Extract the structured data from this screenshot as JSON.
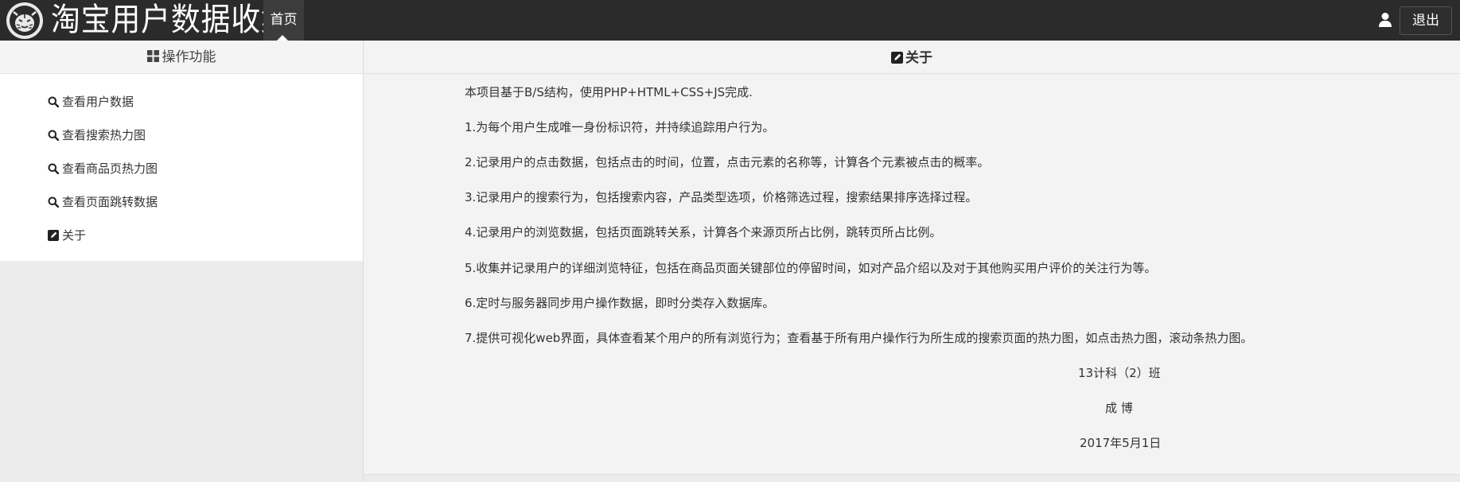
{
  "navbar": {
    "brand_title": "淘宝用户数据收集",
    "home_label": "首页",
    "logout_label": "退出"
  },
  "sidebar": {
    "header": "操作功能",
    "items": [
      {
        "label": "查看用户数据",
        "icon": "search-icon"
      },
      {
        "label": "查看搜索热力图",
        "icon": "search-icon"
      },
      {
        "label": "查看商品页热力图",
        "icon": "search-icon"
      },
      {
        "label": "查看页面跳转数据",
        "icon": "search-icon"
      },
      {
        "label": "关于",
        "icon": "edit-icon"
      }
    ]
  },
  "main": {
    "header": "关于",
    "intro": "本项目基于B/S结构，使用PHP+HTML+CSS+JS完成.",
    "points": [
      "1.为每个用户生成唯一身份标识符，并持续追踪用户行为。",
      "2.记录用户的点击数据，包括点击的时间，位置，点击元素的名称等，计算各个元素被点击的概率。",
      "3.记录用户的搜索行为，包括搜索内容，产品类型选项，价格筛选过程，搜索结果排序选择过程。",
      "4.记录用户的浏览数据，包括页面跳转关系，计算各个来源页所占比例，跳转页所占比例。",
      "5.收集并记录用户的详细浏览特征，包括在商品页面关键部位的停留时间，如对产品介绍以及对于其他购买用户评价的关注行为等。",
      "6.定时与服务器同步用户操作数据，即时分类存入数据库。",
      "7.提供可视化web界面，具体查看某个用户的所有浏览行为；查看基于所有用户操作行为所生成的搜索页面的热力图，如点击热力图，滚动条热力图。"
    ],
    "class_name": "13计科（2）班",
    "author": "成 博",
    "date": "2017年5月1日"
  },
  "colors": {
    "navbar_bg": "#2b2b2b",
    "main_bg": "#f3f3f3",
    "sidebar_menu_bg": "#ffffff"
  }
}
